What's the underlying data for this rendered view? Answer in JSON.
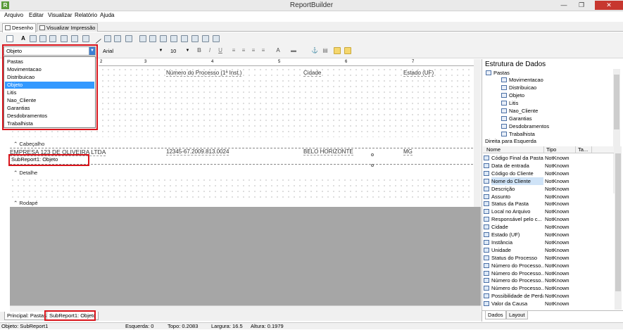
{
  "window": {
    "title": "ReportBuilder",
    "minimize": "—",
    "maximize": "❐",
    "close": "✕"
  },
  "menu": [
    "Arquivo",
    "Editar",
    "Visualizar",
    "Relatório",
    "Ajuda"
  ],
  "tabs": [
    "Desenho",
    "Visualizar Impressão"
  ],
  "toolbar": {
    "object_select": "Objeto",
    "font_name": "Arial",
    "font_size": "10",
    "bold": "B",
    "italic": "I",
    "underline": "U"
  },
  "dropdown_options": [
    "Pastas",
    "Movimentacao",
    "Distribuicao",
    "Objeto",
    "Litis",
    "Nao_Cliente",
    "Garantias",
    "Desdobramentos",
    "Trabalhista"
  ],
  "dropdown_selected": "Objeto",
  "ruler_ticks": [
    "2",
    "3",
    "4",
    "5",
    "6",
    "7"
  ],
  "header_fields": {
    "processo": "Número do Processo (1ª Inst.)",
    "cidade": "Cidade",
    "estado": "Estado (UF)"
  },
  "bands": {
    "cabecalho": "Cabeçalho",
    "detalhe": "Detalhe",
    "rodape": "Rodapé"
  },
  "detail_values": {
    "empresa": "EMPRESA 123 DE OLIVEIRA LTDA",
    "numero": "12345-67.2009.813.0024",
    "cidade": "BELO HORIZONTE",
    "estado": "MG"
  },
  "subreport_label": "SubReport1: Objeto",
  "right_panel": {
    "title": "Estrutura de Dados",
    "tree_root": "Pastas",
    "tree_children": [
      "Movimentacao",
      "Distribuicao",
      "Objeto",
      "Litis",
      "Nao_Cliente",
      "Garantias",
      "Desdobramentos",
      "Trabalhista"
    ],
    "direction_label": "Direita para Esquerda",
    "grid_headers": {
      "nome": "Nome",
      "tipo": "Tipo",
      "ta": "Ta..."
    },
    "grid_rows": [
      {
        "nome": "Código Final da Pasta",
        "tipo": "NotKnown"
      },
      {
        "nome": "Data de entrada",
        "tipo": "NotKnown"
      },
      {
        "nome": "Código do Cliente",
        "tipo": "NotKnown"
      },
      {
        "nome": "Nome do Cliente",
        "tipo": "NotKnown"
      },
      {
        "nome": "Descrição",
        "tipo": "NotKnown"
      },
      {
        "nome": "Assunto",
        "tipo": "NotKnown"
      },
      {
        "nome": "Status da Pasta",
        "tipo": "NotKnown"
      },
      {
        "nome": "Local no Arquivo",
        "tipo": "NotKnown"
      },
      {
        "nome": "Responsável pelo c...",
        "tipo": "NotKnown"
      },
      {
        "nome": "Cidade",
        "tipo": "NotKnown"
      },
      {
        "nome": "Estado (UF)",
        "tipo": "NotKnown"
      },
      {
        "nome": "Instância",
        "tipo": "NotKnown"
      },
      {
        "nome": "Unidade",
        "tipo": "NotKnown"
      },
      {
        "nome": "Status do Processo",
        "tipo": "NotKnown"
      },
      {
        "nome": "Número do Processo...",
        "tipo": "NotKnown"
      },
      {
        "nome": "Número do Processo...",
        "tipo": "NotKnown"
      },
      {
        "nome": "Número do Processo...",
        "tipo": "NotKnown"
      },
      {
        "nome": "Número do Processo...",
        "tipo": "NotKnown"
      },
      {
        "nome": "Possibilidade de Perda",
        "tipo": "NotKnown"
      },
      {
        "nome": "Valor da Causa",
        "tipo": "NotKnown"
      }
    ],
    "bottom_tabs": [
      "Dados",
      "Layout"
    ]
  },
  "bottom_tabs": [
    "Principal: Pastas",
    "SubReport1: Objeto"
  ],
  "status": {
    "obj": "Objeto: SubReport1",
    "esq": "Esquerda: 0",
    "topo": "Topo: 0.2083",
    "larg": "Largura: 16.5",
    "alt": "Altura: 0.1979"
  },
  "colors": {
    "highlight": "#d9141b",
    "selection": "#3399ff"
  }
}
